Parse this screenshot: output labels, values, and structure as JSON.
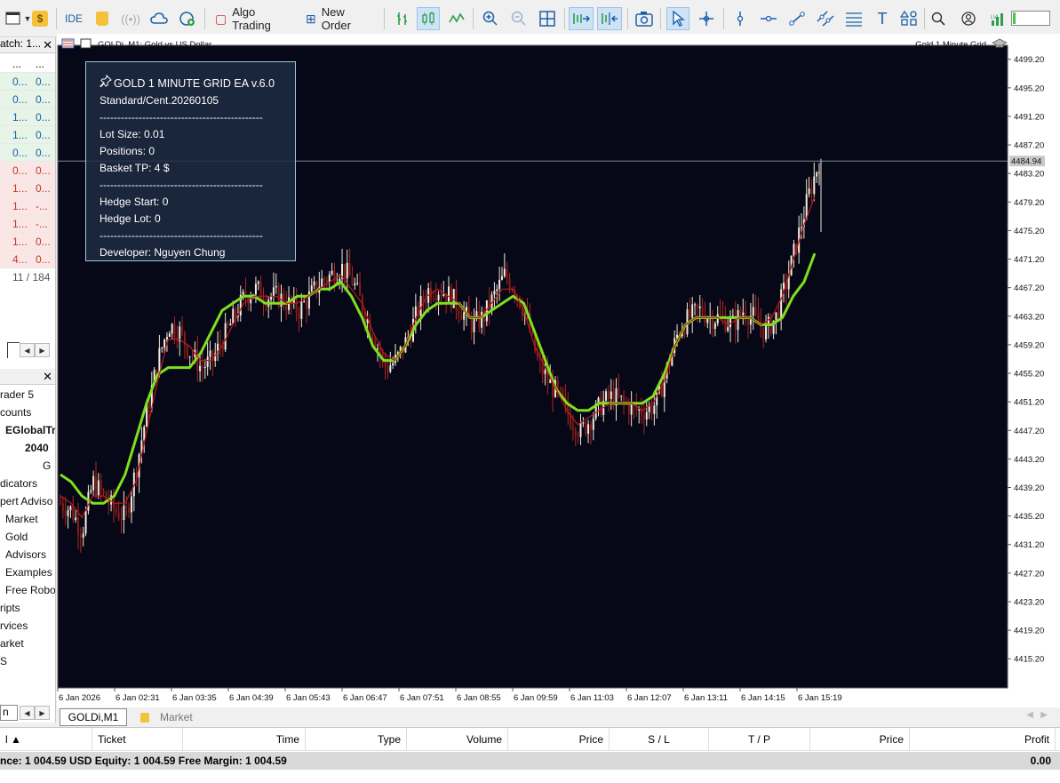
{
  "toolbar": {
    "ide_label": "IDE",
    "algo_trading_label": "Algo Trading",
    "new_order_label": "New Order"
  },
  "market_watch": {
    "title": "atch: 1...",
    "rows": [
      {
        "a": "...",
        "b": "...",
        "color": "dark"
      },
      {
        "a": "0...",
        "b": "0...",
        "color": "blue"
      },
      {
        "a": "0...",
        "b": "0...",
        "color": "blue"
      },
      {
        "a": "1...",
        "b": "0...",
        "color": "blue"
      },
      {
        "a": "1...",
        "b": "0...",
        "color": "blue"
      },
      {
        "a": "0...",
        "b": "0...",
        "color": "blue"
      },
      {
        "a": "0...",
        "b": "0...",
        "color": "red"
      },
      {
        "a": "1...",
        "b": "0...",
        "color": "red"
      },
      {
        "a": "1...",
        "b": "-...",
        "color": "red"
      },
      {
        "a": "1...",
        "b": "-...",
        "color": "red"
      },
      {
        "a": "1...",
        "b": "0...",
        "color": "red"
      },
      {
        "a": "4...",
        "b": "0...",
        "color": "red"
      }
    ],
    "count": "11 / 184"
  },
  "navigator": {
    "items": [
      {
        "text": "rader 5",
        "bold": false
      },
      {
        "text": "counts",
        "bold": false
      },
      {
        "text": "EGlobalTr",
        "bold": true
      },
      {
        "text": "2040",
        "bold": true
      },
      {
        "text": "G",
        "bold": false
      },
      {
        "text": "dicators",
        "bold": false
      },
      {
        "text": "pert Adviso",
        "bold": false
      },
      {
        "text": "Market",
        "bold": false
      },
      {
        "text": "Gold",
        "bold": false
      },
      {
        "text": "Advisors",
        "bold": false
      },
      {
        "text": "Examples",
        "bold": false
      },
      {
        "text": "Free Robo",
        "bold": false
      },
      {
        "text": "ripts",
        "bold": false
      },
      {
        "text": "rvices",
        "bold": false
      },
      {
        "text": "arket",
        "bold": false
      },
      {
        "text": "S",
        "bold": false
      }
    ],
    "bottom_tab": "n"
  },
  "chart_header": {
    "symbol": "GOLDi, M1:  Gold vs US Dollar",
    "ea_name": "Gold 1 Minute Grid"
  },
  "ea_panel": {
    "title": "GOLD 1 MINUTE GRID EA v.6.0",
    "account_type": "Standard/Cent.20260105",
    "divider": "----------------------------------------------",
    "lot_size": "Lot Size: 0.01",
    "positions": "Positions: 0",
    "basket_tp": "Basket TP: 4 $",
    "hedge_start": "Hedge Start: 0",
    "hedge_lot": "Hedge Lot: 0",
    "developer": "Developer: Nguyen Chung"
  },
  "chart_data": {
    "type": "candlestick",
    "symbol": "GOLDi",
    "timeframe": "M1",
    "ylim": [
      4412,
      4502
    ],
    "y_ticks": [
      "4499.20",
      "4495.20",
      "4491.20",
      "4487.20",
      "4483.20",
      "4479.20",
      "4475.20",
      "4471.20",
      "4467.20",
      "4463.20",
      "4459.20",
      "4455.20",
      "4451.20",
      "4447.20",
      "4443.20",
      "4439.20",
      "4435.20",
      "4431.20",
      "4427.20",
      "4423.20",
      "4419.20",
      "4415.20"
    ],
    "x_ticks": [
      "6 Jan 2026",
      "6 Jan 02:31",
      "6 Jan 03:35",
      "6 Jan 04:39",
      "6 Jan 05:43",
      "6 Jan 06:47",
      "6 Jan 07:51",
      "6 Jan 08:55",
      "6 Jan 09:59",
      "6 Jan 11:03",
      "6 Jan 12:07",
      "6 Jan 13:11",
      "6 Jan 14:15",
      "6 Jan 15:19"
    ],
    "current_price": "4484.94",
    "current_price_value": 4484.94,
    "price_path": [
      4437,
      4436,
      4433,
      4440,
      4438,
      4436,
      4435,
      4442,
      4450,
      4457,
      4462,
      4461,
      4458,
      4456,
      4457,
      4460,
      4463,
      4466,
      4467,
      4466,
      4466,
      4465,
      4464,
      4466,
      4468,
      4469,
      4470,
      4468,
      4464,
      4460,
      4456,
      4457,
      4460,
      4464,
      4467,
      4467,
      4466,
      4464,
      4462,
      4463,
      4466,
      4469,
      4467,
      4463,
      4457,
      4454,
      4452,
      4449,
      4447,
      4449,
      4451,
      4452,
      4451,
      4450,
      4450,
      4451,
      4456,
      4461,
      4463,
      4464,
      4463,
      4463,
      4462,
      4464,
      4463,
      4461,
      4463,
      4468,
      4474,
      4480,
      4484.94
    ],
    "series": [
      {
        "name": "",
        "color": "#7fe01e",
        "values": [
          4441,
          4440,
          4438,
          4437,
          4437,
          4438,
          4441,
          4446,
          4451,
          4455,
          4456,
          4456,
          4456,
          4458,
          4461,
          4464,
          4465,
          4466,
          4466,
          4465,
          4465,
          4465,
          4466,
          4466,
          4467,
          4467,
          4468,
          4466,
          4463,
          4459,
          4457,
          4457,
          4459,
          4462,
          4464,
          4465,
          4465,
          4465,
          4463,
          4463,
          4464,
          4465,
          4466,
          4465,
          4461,
          4457,
          4453,
          4451,
          4450,
          4450,
          4451,
          4451,
          4451,
          4451,
          4451,
          4452,
          4455,
          4459,
          4462,
          4463,
          4463,
          4463,
          4463,
          4463,
          4463,
          4462,
          4462,
          4463,
          4466,
          4468,
          4472
        ]
      },
      {
        "name": "",
        "color": "#c0191e",
        "values": [
          4438,
          4437,
          4435,
          4438,
          4438,
          4437,
          4437,
          4440,
          4447,
          4454,
          4460,
          4460,
          4459,
          4457,
          4457,
          4459,
          4462,
          4465,
          4466,
          4466,
          4466,
          4465,
          4465,
          4466,
          4467,
          4468,
          4469,
          4467,
          4465,
          4461,
          4458,
          4457,
          4459,
          4463,
          4466,
          4467,
          4466,
          4465,
          4463,
          4463,
          4465,
          4467,
          4467,
          4464,
          4459,
          4456,
          4453,
          4450,
          4448,
          4449,
          4450,
          4451,
          4451,
          4451,
          4450,
          4451,
          4454,
          4459,
          4462,
          4463,
          4463,
          4463,
          4462,
          4463,
          4463,
          4462,
          4463,
          4466,
          4471,
          4476,
          4480
        ]
      }
    ],
    "grid": false
  },
  "tabs": {
    "active": "GOLDi,M1",
    "second": "Market"
  },
  "toolbox": {
    "columns": [
      "l",
      "Ticket",
      "Time",
      "Type",
      "Volume",
      "Price",
      "S / L",
      "T / P",
      "Price",
      "Profit"
    ],
    "balance_line": "nce: 1 004.59 USD  Equity: 1 004.59  Free Margin: 1 004.59",
    "profit_total": "0.00"
  },
  "level_indicator": {
    "label": "LVL",
    "fill_fraction": 0.08
  }
}
